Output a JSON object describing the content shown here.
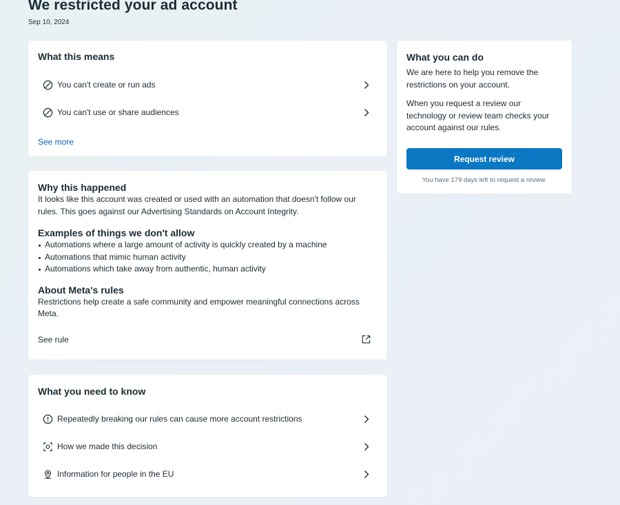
{
  "header": {
    "title": "We restricted your ad account",
    "date": "Sep 10, 2024"
  },
  "what_this_means": {
    "title": "What this means",
    "items": [
      {
        "label": "You can't create or run ads",
        "icon": "prohibited-icon"
      },
      {
        "label": "You can't use or share audiences",
        "icon": "prohibited-icon"
      }
    ],
    "see_more": "See more"
  },
  "why": {
    "title": "Why this happened",
    "text": "It looks like this account was created or used with an automation that doesn't follow our rules. This goes against our Advertising Standards on Account Integrity.",
    "examples_title": "Examples of things we don't allow",
    "examples": [
      "Automations where a large amount of activity is quickly created by a machine",
      "Automations that mimic human activity",
      "Automations which take away from authentic, human activity"
    ],
    "about_title": "About Meta's rules",
    "about_text": "Restrictions help create a safe community and empower meaningful connections across Meta.",
    "see_rule": "See rule"
  },
  "need_to_know": {
    "title": "What you need to know",
    "items": [
      {
        "label": "Repeatedly breaking our rules can cause more account restrictions",
        "icon": "alert-circle-icon"
      },
      {
        "label": "How we made this decision",
        "icon": "scan-icon"
      },
      {
        "label": "Information for people in the EU",
        "icon": "location-pin-icon"
      }
    ]
  },
  "sidebar": {
    "title": "What you can do",
    "text1": "We are here to help you remove the restrictions on your account.",
    "text2": "When you request a review our technology or review team checks your account against our rules.",
    "button": "Request review",
    "note": "You have 179 days left to request a review."
  },
  "colors": {
    "accent": "#0a78c2",
    "link": "#0a66c2",
    "text": "#1c2b33"
  }
}
